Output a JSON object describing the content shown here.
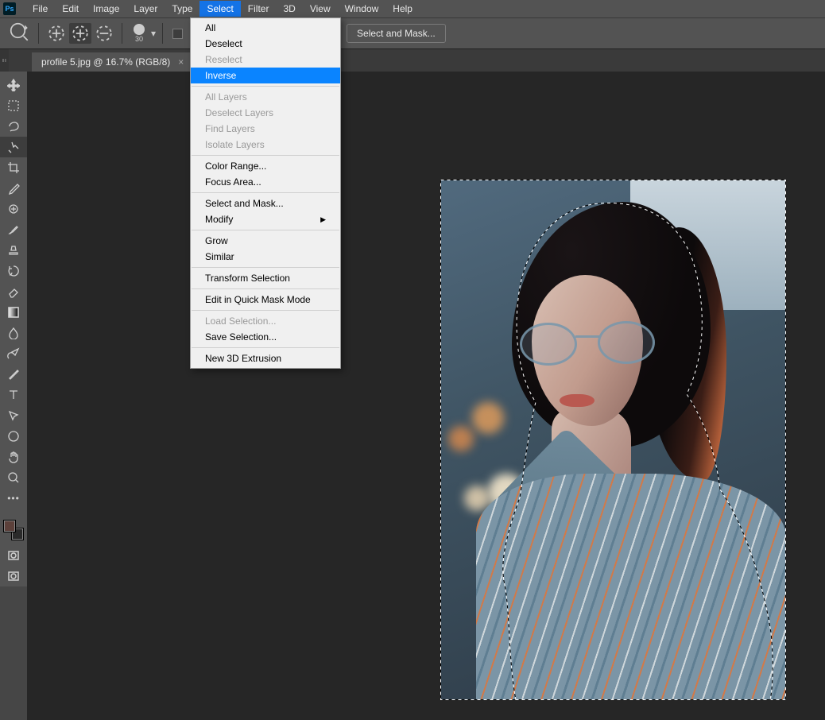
{
  "app": "Photoshop",
  "menubar": [
    "File",
    "Edit",
    "Image",
    "Layer",
    "Type",
    "Select",
    "Filter",
    "3D",
    "View",
    "Window",
    "Help"
  ],
  "menubar_open": "Select",
  "optionsbar": {
    "brush_size": "30",
    "select_mask_btn": "Select and Mask..."
  },
  "document": {
    "tab_label": "profile 5.jpg @ 16.7% (RGB/8)"
  },
  "select_menu": {
    "groups": [
      [
        {
          "label": "All"
        },
        {
          "label": "Deselect"
        },
        {
          "label": "Reselect",
          "dis": true
        },
        {
          "label": "Inverse",
          "hl": true
        }
      ],
      [
        {
          "label": "All Layers",
          "dis": true
        },
        {
          "label": "Deselect Layers",
          "dis": true
        },
        {
          "label": "Find Layers",
          "dis": true
        },
        {
          "label": "Isolate Layers",
          "dis": true
        }
      ],
      [
        {
          "label": "Color Range..."
        },
        {
          "label": "Focus Area..."
        }
      ],
      [
        {
          "label": "Select and Mask..."
        },
        {
          "label": "Modify",
          "sub": true
        }
      ],
      [
        {
          "label": "Grow"
        },
        {
          "label": "Similar"
        }
      ],
      [
        {
          "label": "Transform Selection"
        }
      ],
      [
        {
          "label": "Edit in Quick Mask Mode"
        }
      ],
      [
        {
          "label": "Load Selection...",
          "dis": true
        },
        {
          "label": "Save Selection..."
        }
      ],
      [
        {
          "label": "New 3D Extrusion"
        }
      ]
    ]
  },
  "tools": [
    "move",
    "marquee",
    "lasso",
    "quick-select",
    "crop",
    "eyedropper",
    "healing",
    "brush",
    "stamp",
    "history-brush",
    "eraser",
    "gradient",
    "blur",
    "dodge",
    "pen",
    "type",
    "path-select",
    "shape",
    "hand",
    "zoom"
  ],
  "tool_selected": "quick-select",
  "swatch_fg": "#5c403a",
  "swatch_bg": "#2a2a2a"
}
